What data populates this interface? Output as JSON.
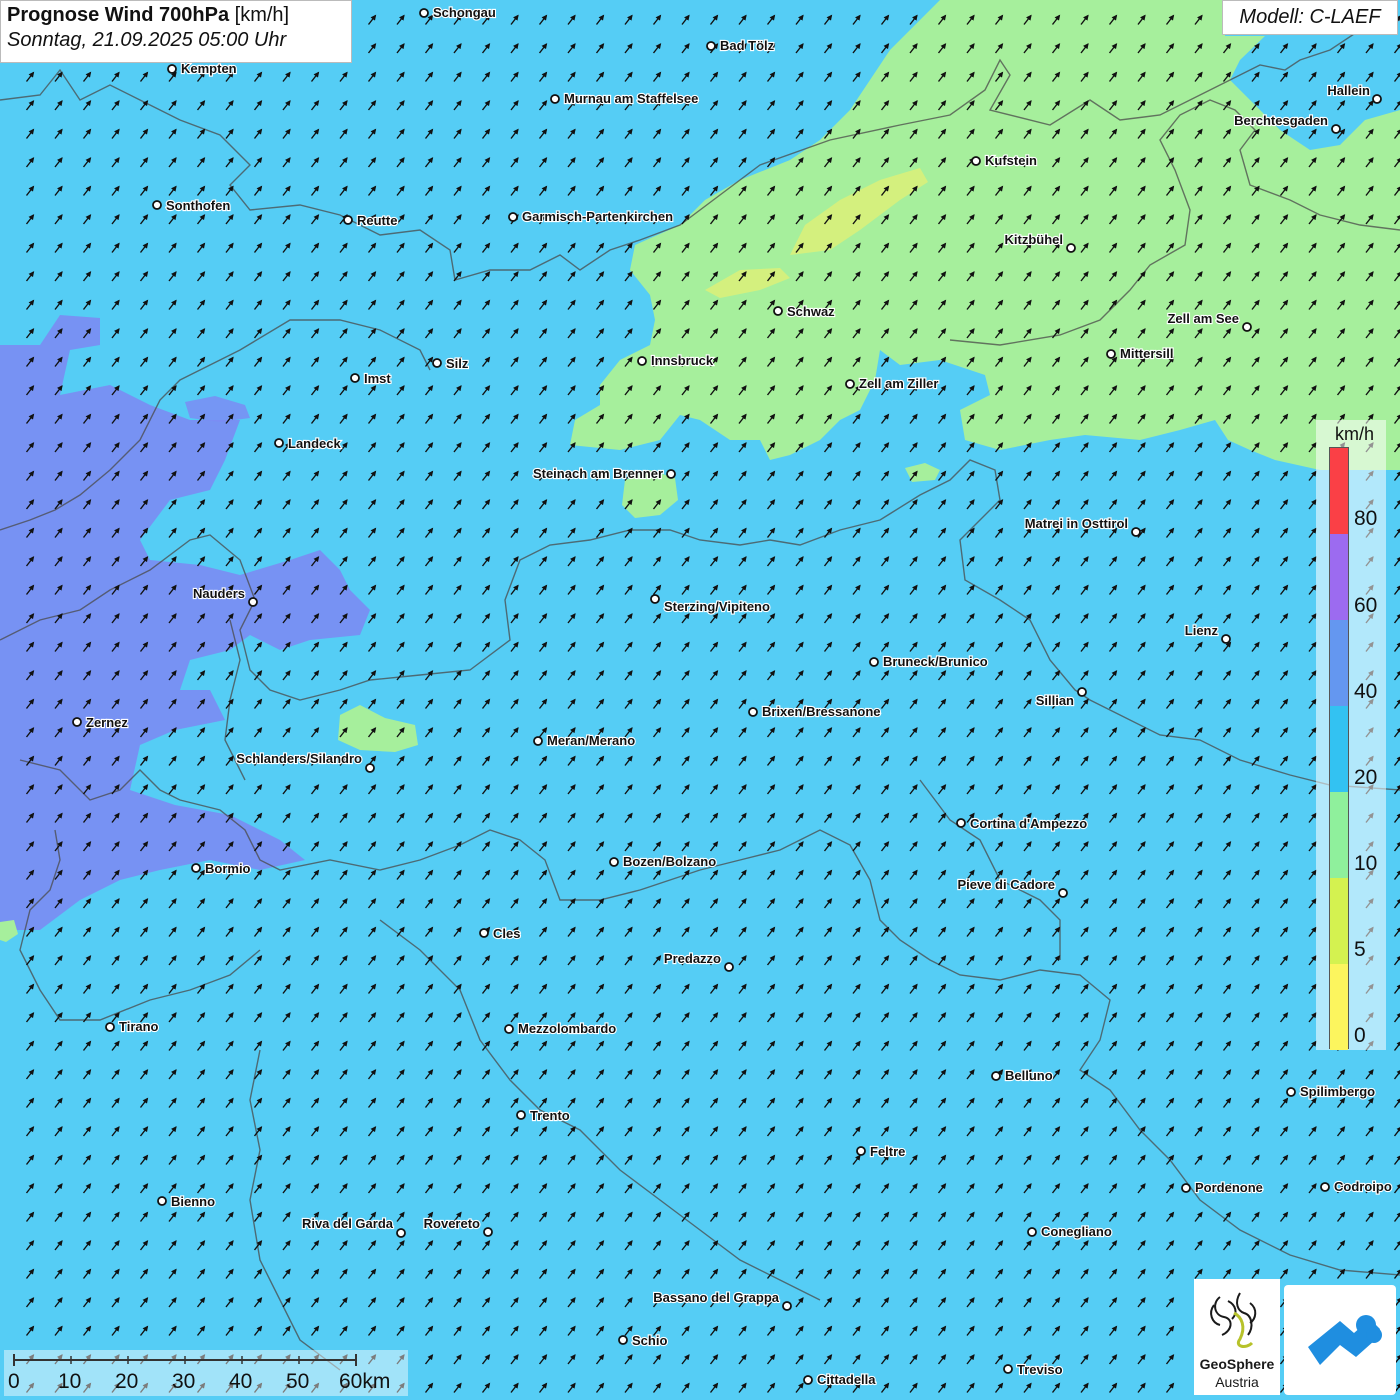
{
  "header": {
    "title_bold": "Prognose Wind 700hPa",
    "title_unit": "[km/h]",
    "datetime": "Sonntag, 21.09.2025 05:00 Uhr"
  },
  "model": "Modell: C-LAEF",
  "legend": {
    "unit": "km/h",
    "ticks": [
      "80",
      "60",
      "40",
      "20",
      "10",
      "5",
      "0"
    ],
    "colors": [
      "#fa4046",
      "#9c6bf0",
      "#6497f0",
      "#33c2f2",
      "#8ff09c",
      "#d4f250",
      "#fcf55e"
    ]
  },
  "scale_bar": {
    "labels": [
      "0",
      "10",
      "20",
      "30",
      "40",
      "50",
      "60km"
    ]
  },
  "logos": {
    "geosphere_name": "GeoSphere",
    "geosphere_sub": "Austria"
  },
  "map_colors": {
    "wind_20_40": "#55cdf5",
    "wind_10_20": "#a6ef9c",
    "wind_5_10": "#d4f07e",
    "wind_40_60": "#7b8cf3",
    "wind_60_80": "#8e76ec"
  },
  "cities": [
    "Schongau",
    "Bad Tölz",
    "Kempten",
    "Murnau am Staffelsee",
    "Hallein",
    "Berchtesgaden",
    "Kufstein",
    "Sonthofen",
    "Reutte",
    "Garmisch-Partenkirchen",
    "Kitzbühel",
    "Schwaz",
    "Zell am See",
    "Mittersill",
    "Innsbruck",
    "Silz",
    "Imst",
    "Zell am Ziller",
    "Landeck",
    "Steinach am Brenner",
    "Matrei in Osttirol",
    "Nauders",
    "Sterzing/Vipiteno",
    "Lienz",
    "Bruneck/Brunico",
    "Sillian",
    "Brixen/Bressanone",
    "Zernez",
    "Meran/Merano",
    "Schlanders/Silandro",
    "Cortina d'Ampezzo",
    "Bozen/Bolzano",
    "Bormio",
    "Pieve di Cadore",
    "Cles",
    "Predazzo",
    "Tirano",
    "Mezzolombardo",
    "Belluno",
    "Spilimbergo",
    "Trento",
    "Feltre",
    "Bienno",
    "Pordenone",
    "Codroipo",
    "Riva del Garda",
    "Rovereto",
    "Conegliano",
    "Bassano del Grappa",
    "Schio",
    "Treviso",
    "Cittadella"
  ]
}
